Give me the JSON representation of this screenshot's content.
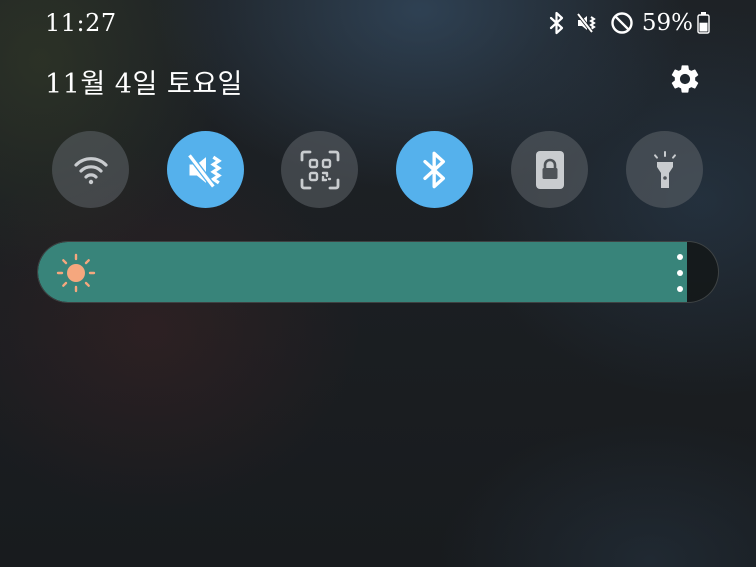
{
  "status_bar": {
    "time": "11:27",
    "icons": [
      "bluetooth-icon",
      "vibrate-icon",
      "do-not-disturb-icon"
    ],
    "battery_percent": "59%",
    "battery_level": 0.59
  },
  "header": {
    "date": "11월 4일 토요일",
    "settings_icon": "gear-icon"
  },
  "quick_toggles": [
    {
      "icon": "wifi-icon",
      "active": false
    },
    {
      "icon": "vibrate-icon",
      "active": true
    },
    {
      "icon": "qr-scanner-icon",
      "active": false
    },
    {
      "icon": "bluetooth-icon",
      "active": true
    },
    {
      "icon": "lock-icon",
      "active": false
    },
    {
      "icon": "flashlight-icon",
      "active": false
    }
  ],
  "brightness": {
    "level": 0.955,
    "icon": "sun-icon",
    "menu_icon": "more-options-icon"
  },
  "colors": {
    "active_toggle": "#55b1ec",
    "inactive_toggle": "#5f6469",
    "brightness_fill": "#38847a",
    "sun": "#f5a77e"
  }
}
